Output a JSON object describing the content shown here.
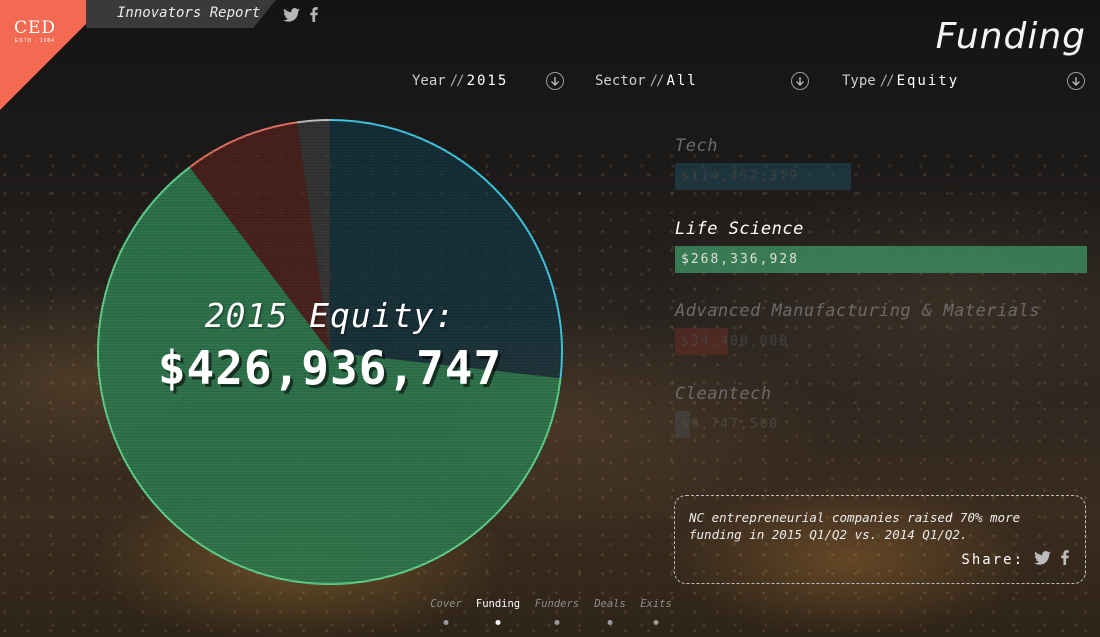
{
  "brand": {
    "logo": "CED",
    "logo_sub": "ESTD · 1984",
    "report_label": "Innovators Report",
    "accent": "#f26a52"
  },
  "header": {
    "title": "Funding",
    "social": [
      "twitter-icon",
      "facebook-icon"
    ]
  },
  "filters": [
    {
      "label": "Year",
      "value": "2015"
    },
    {
      "label": "Sector",
      "value": "All"
    },
    {
      "label": "Type",
      "value": "Equity"
    }
  ],
  "summary": {
    "caption": "2015 Equity:",
    "total": "$426,936,747"
  },
  "sectors": [
    {
      "name": "Tech",
      "amount": "$114,452,319",
      "value": 114452319,
      "color": "#1e4b5a",
      "active": false
    },
    {
      "name": "Life Science",
      "amount": "$268,336,928",
      "value": 268336928,
      "color": "#3c8a5c",
      "active": true
    },
    {
      "name": "Advanced Manufacturing & Materials",
      "amount": "$34,400,000",
      "value": 34400000,
      "color": "#6b2a24",
      "active": false
    },
    {
      "name": "Cleantech",
      "amount": "$9,747,500",
      "value": 9747500,
      "color": "#4a4a4a",
      "active": false
    }
  ],
  "info": {
    "text": "NC entrepreneurial companies raised 70% more funding in 2015 Q1/Q2 vs. 2014 Q1/Q2.",
    "share_label": "Share:"
  },
  "nav": [
    {
      "label": "Cover",
      "active": false
    },
    {
      "label": "Funding",
      "active": true
    },
    {
      "label": "Funders",
      "active": false
    },
    {
      "label": "Deals",
      "active": false
    },
    {
      "label": "Exits",
      "active": false
    }
  ]
}
